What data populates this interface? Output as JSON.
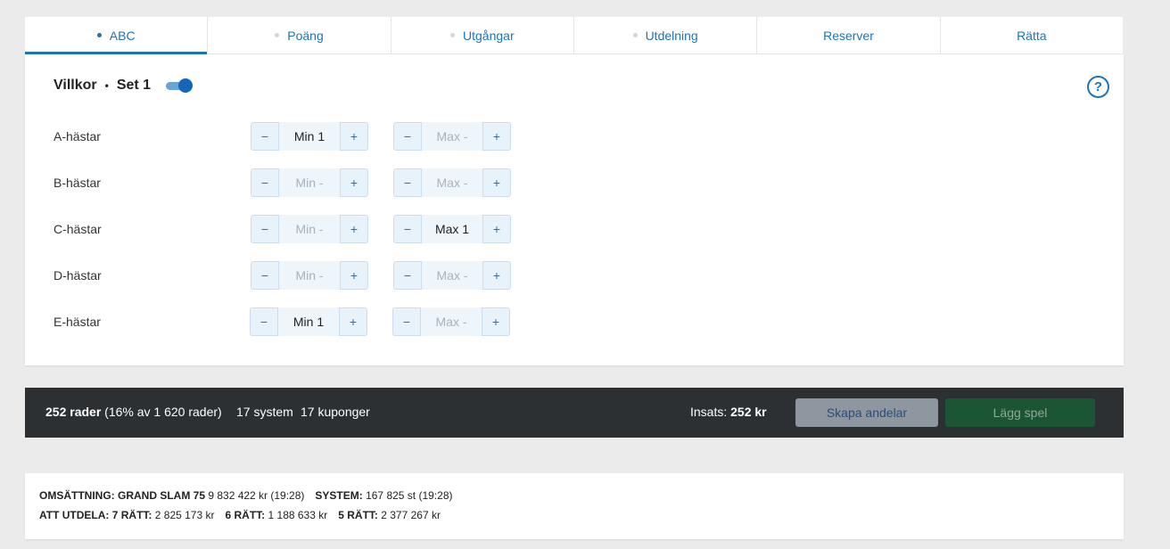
{
  "tabs": [
    {
      "label": "ABC",
      "dot": true,
      "active": true
    },
    {
      "label": "Poäng",
      "dot": true,
      "active": false
    },
    {
      "label": "Utgångar",
      "dot": true,
      "active": false
    },
    {
      "label": "Utdelning",
      "dot": true,
      "active": false
    },
    {
      "label": "Reserver",
      "dot": false,
      "active": false
    },
    {
      "label": "Rätta",
      "dot": false,
      "active": false
    }
  ],
  "villkor": {
    "title": "Villkor",
    "separator": "•",
    "set_label": "Set 1",
    "toggle_on": true,
    "help_icon": "?"
  },
  "rows": [
    {
      "label": "A-hästar",
      "min": "Min 1",
      "max": "Max -"
    },
    {
      "label": "B-hästar",
      "min": "Min -",
      "max": "Max -"
    },
    {
      "label": "C-hästar",
      "min": "Min -",
      "max": "Max 1"
    },
    {
      "label": "D-hästar",
      "min": "Min -",
      "max": "Max -"
    },
    {
      "label": "E-hästar",
      "min": "Min 1",
      "max": "Max -"
    }
  ],
  "stepper": {
    "minus": "−",
    "plus": "+"
  },
  "summary": {
    "rows_count": "252 rader",
    "rows_detail": " (16% av 1 620 rader)",
    "system": "17 system",
    "kuponger": "17 kuponger",
    "insats_label": "Insats: ",
    "insats_value": "252 kr",
    "create_shares": "Skapa andelar",
    "place_bet": "Lägg spel"
  },
  "info": {
    "omsattning_label": "OMSÄTTNING: GRAND SLAM 75",
    "omsattning_value": " 9 832 422 kr  (19:28)",
    "system_label": "SYSTEM:",
    "system_value": " 167 825 st  (19:28)",
    "att_utdela_label": "ATT UTDELA: 7 RÄTT:",
    "att_utdela_value": " 2 825 173 kr",
    "six_label": "6 RÄTT:",
    "six_value": " 1 188 633 kr",
    "five_label": "5 RÄTT:",
    "five_value": " 2 377 267 kr"
  },
  "colors": {
    "accent": "#1f73b7",
    "summary_bg": "#2d3033",
    "create_shares_bg": "#8e979f",
    "place_bet_bg": "#1c5533"
  }
}
